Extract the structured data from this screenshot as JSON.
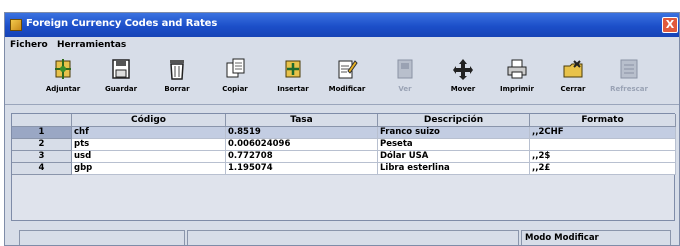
{
  "window": {
    "title": "Foreign Currency Codes and Rates",
    "close_label": "X"
  },
  "menu": [
    {
      "label": "Fichero"
    },
    {
      "label": "Herramientas"
    }
  ],
  "toolbar": [
    {
      "label": "Adjuntar",
      "icon": "attach-icon",
      "enabled": true
    },
    {
      "label": "Guardar",
      "icon": "save-icon",
      "enabled": true
    },
    {
      "label": "Borrar",
      "icon": "trash-icon",
      "enabled": true
    },
    {
      "label": "Copiar",
      "icon": "copy-icon",
      "enabled": true
    },
    {
      "label": "Insertar",
      "icon": "insert-icon",
      "enabled": true
    },
    {
      "label": "Modificar",
      "icon": "edit-icon",
      "enabled": true
    },
    {
      "label": "Ver",
      "icon": "view-icon",
      "enabled": false
    },
    {
      "label": "Mover",
      "icon": "move-icon",
      "enabled": true
    },
    {
      "label": "Imprimir",
      "icon": "print-icon",
      "enabled": true
    },
    {
      "label": "Cerrar",
      "icon": "close-folder-icon",
      "enabled": true
    },
    {
      "label": "Refrescar",
      "icon": "refresh-icon",
      "enabled": false
    }
  ],
  "table": {
    "columns": [
      "Código",
      "Tasa",
      "Descripción",
      "Formato"
    ],
    "rows": [
      {
        "num": "1",
        "codigo": "chf",
        "tasa": "0.8519",
        "descripcion": "Franco suizo",
        "formato": ",,2CHF",
        "selected": true
      },
      {
        "num": "2",
        "codigo": "pts",
        "tasa": "0.006024096",
        "descripcion": "Peseta",
        "formato": "",
        "selected": false
      },
      {
        "num": "3",
        "codigo": "usd",
        "tasa": "0.772708",
        "descripcion": "Dólar USA",
        "formato": ",,2$",
        "selected": false
      },
      {
        "num": "4",
        "codigo": "gbp",
        "tasa": "1.195074",
        "descripcion": "Libra esterlina",
        "formato": ",,2£",
        "selected": false
      }
    ]
  },
  "status": {
    "pane1": "",
    "pane2": "",
    "pane3": "Modo Modificar"
  },
  "colors": {
    "titlebar": "#1c4fc9",
    "selected_row": "#c3cde2",
    "window_bg": "#d7dde8"
  }
}
